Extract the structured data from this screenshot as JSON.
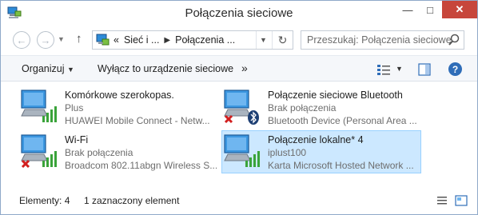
{
  "window": {
    "title": "Połączenia sieciowe"
  },
  "navigation": {
    "breadcrumb": [
      "«",
      "Sieć i ...",
      "Połączenia ..."
    ],
    "search_placeholder": "Przeszukaj: Połączenia sieciowe"
  },
  "commandbar": {
    "organize_label": "Organizuj",
    "disable_label": "Wyłącz to urządzenie sieciowe",
    "more_label": "»"
  },
  "connections": [
    {
      "name": "Komórkowe szerokopas.",
      "status": "Plus",
      "device": "HUAWEI Mobile Connect - Netw...",
      "type": "mobile",
      "disconnected": false,
      "selected": false
    },
    {
      "name": "Połączenie sieciowe Bluetooth",
      "status": "Brak połączenia",
      "device": "Bluetooth Device (Personal Area ...",
      "type": "bluetooth",
      "disconnected": true,
      "selected": false
    },
    {
      "name": "Wi-Fi",
      "status": "Brak połączenia",
      "device": "Broadcom 802.11abgn Wireless S...",
      "type": "wifi",
      "disconnected": true,
      "selected": false
    },
    {
      "name": "Połączenie lokalne* 4",
      "status": "iplust100",
      "device": "Karta Microsoft Hosted Network ...",
      "type": "wifi",
      "disconnected": false,
      "selected": true
    }
  ],
  "statusbar": {
    "count": "Elementy: 4",
    "selection": "1 zaznaczony element"
  },
  "colors": {
    "selection_bg": "#cce8ff",
    "selection_border": "#99d1ff",
    "close_button": "#c7463b",
    "help_blue": "#2f6db8",
    "signal_green": "#3aa33a",
    "error_red": "#d21f1f"
  }
}
